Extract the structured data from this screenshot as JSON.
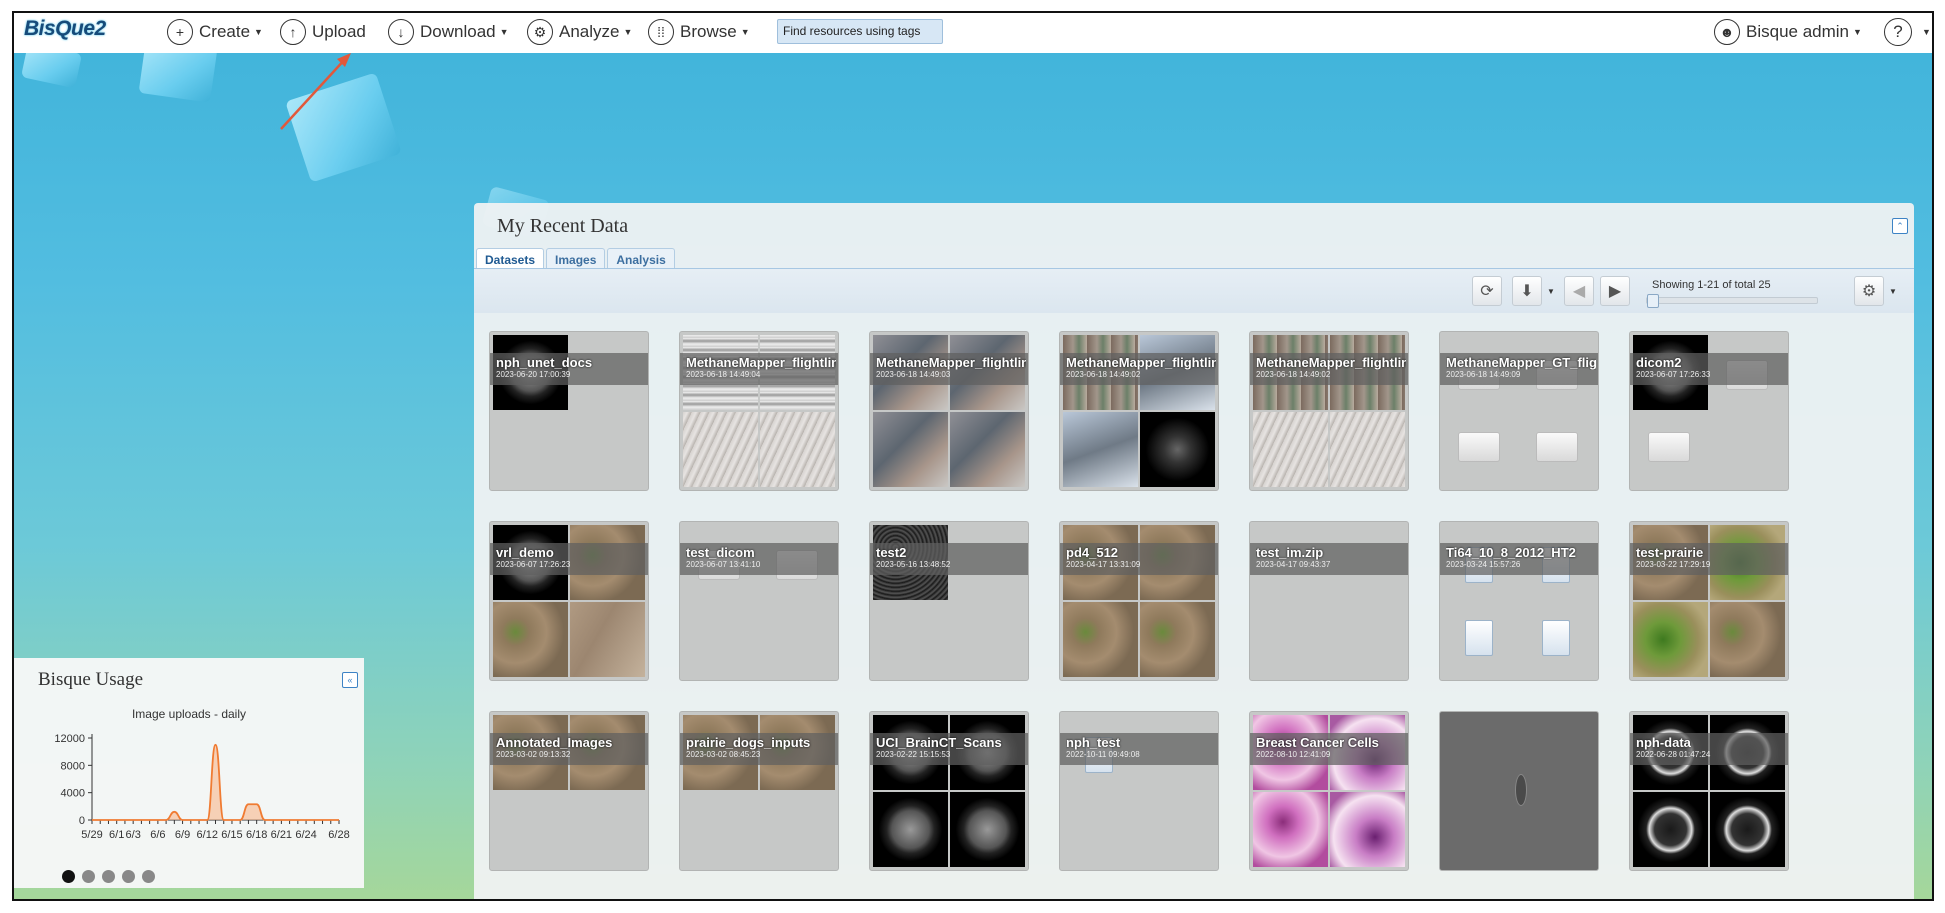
{
  "app": {
    "logo": "BisQue2"
  },
  "menu": {
    "create": "Create",
    "upload": "Upload",
    "download": "Download",
    "analyze": "Analyze",
    "browse": "Browse",
    "tag_search_placeholder": "Find resources using tags",
    "user": "Bisque admin"
  },
  "recent": {
    "title": "My Recent Data",
    "tabs": [
      "Datasets",
      "Images",
      "Analysis"
    ],
    "showing": "Showing 1-21 of total 25",
    "items": [
      {
        "name": "nph_unet_docs",
        "date": "2023-06-20 17:00:39"
      },
      {
        "name": "MethaneMapper_flightlines",
        "date": "2023-06-18 14:49:04"
      },
      {
        "name": "MethaneMapper_flightlines",
        "date": "2023-06-18 14:49:03"
      },
      {
        "name": "MethaneMapper_flightlines",
        "date": "2023-06-18 14:49:02"
      },
      {
        "name": "MethaneMapper_flightlines",
        "date": "2023-06-18 14:49:02"
      },
      {
        "name": "MethaneMapper_GT_flightlines",
        "date": "2023-06-18 14:49:09"
      },
      {
        "name": "dicom2",
        "date": "2023-06-07 17:26:33"
      },
      {
        "name": "vrl_demo",
        "date": "2023-06-07 17:26:23"
      },
      {
        "name": "test_dicom",
        "date": "2023-06-07 13:41:10"
      },
      {
        "name": "test2",
        "date": "2023-05-16 13:48:52"
      },
      {
        "name": "pd4_512",
        "date": "2023-04-17 13:31:09"
      },
      {
        "name": "test_im.zip",
        "date": "2023-04-17 09:43:37"
      },
      {
        "name": "Ti64_10_8_2012_HT2",
        "date": "2023-03-24 15:57:26"
      },
      {
        "name": "test-prairie",
        "date": "2023-03-22 17:29:19"
      },
      {
        "name": "Annotated_Images",
        "date": "2023-03-02 09:13:32"
      },
      {
        "name": "prairie_dogs_inputs",
        "date": "2023-03-02 08:45:23"
      },
      {
        "name": "UCI_BrainCT_Scans",
        "date": "2023-02-22 15:15:53"
      },
      {
        "name": "nph_test",
        "date": "2022-10-11 09:49:08"
      },
      {
        "name": "Breast Cancer Cells",
        "date": "2022-08-10 12:41:09"
      },
      {
        "name": "",
        "date": ""
      },
      {
        "name": "nph-data",
        "date": "2022-06-28 01:47:24"
      }
    ]
  },
  "usage": {
    "title": "Bisque Usage",
    "chart_data": {
      "type": "area",
      "title": "Image uploads - daily",
      "x": [
        "5/29",
        "5/30",
        "5/31",
        "6/1",
        "6/2",
        "6/3",
        "6/4",
        "6/5",
        "6/6",
        "6/7",
        "6/8",
        "6/9",
        "6/10",
        "6/11",
        "6/12",
        "6/13",
        "6/14",
        "6/15",
        "6/16",
        "6/17",
        "6/18",
        "6/19",
        "6/20",
        "6/21",
        "6/22",
        "6/23",
        "6/24",
        "6/25",
        "6/26",
        "6/27",
        "6/28"
      ],
      "tick_labels": [
        "5/29",
        "6/1",
        "6/3",
        "6/6",
        "6/9",
        "6/12",
        "6/15",
        "6/18",
        "6/21",
        "6/24",
        "6/28"
      ],
      "yticks": [
        0,
        4000,
        8000,
        12000
      ],
      "ylim": [
        0,
        12000
      ],
      "values": [
        0,
        0,
        0,
        0,
        0,
        0,
        0,
        0,
        0,
        0,
        1200,
        0,
        0,
        0,
        0,
        11000,
        0,
        0,
        0,
        2300,
        2300,
        0,
        0,
        0,
        0,
        0,
        0,
        0,
        0,
        0,
        0
      ],
      "color": "#f07b32"
    },
    "pages": 5,
    "active_page": 1
  }
}
